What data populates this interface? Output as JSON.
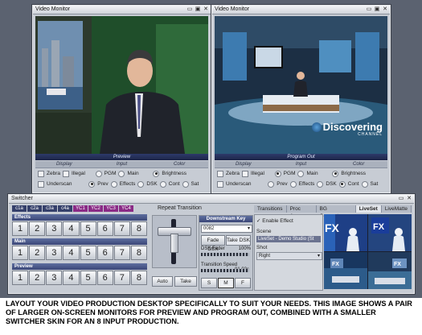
{
  "preview_window": {
    "title": "Video Monitor",
    "bar_label": "Preview",
    "headers": [
      "Display",
      "Input",
      "Color"
    ],
    "row1": {
      "zebra": "Zebra",
      "illegal": "Illegal",
      "pgm": "PGM",
      "main": "Main",
      "brightness": "Brightness"
    },
    "row2": {
      "underscan": "Underscan",
      "prev": "Prev",
      "effects": "Effects",
      "dsk": "DSK",
      "cont": "Cont",
      "sat": "Sat"
    }
  },
  "program_window": {
    "title": "Video Monitor",
    "bar_label": "Program Out",
    "headers": [
      "Display",
      "Input",
      "Color"
    ],
    "row1": {
      "zebra": "Zebra",
      "illegal": "Illegal",
      "pgm": "PGM",
      "main": "Main",
      "brightness": "Brightness"
    },
    "row2": {
      "underscan": "Underscan",
      "prev": "Prev",
      "effects": "Effects",
      "dsk": "DSK",
      "cont": "Cont",
      "sat": "Sat"
    },
    "logo_text": "Discovering",
    "logo_sub": "CHANNEL"
  },
  "switcher": {
    "title": "Switcher",
    "source_tabs": [
      "c1a",
      "c2a",
      "c3a",
      "c4a",
      "YC1",
      "YC2",
      "YC3",
      "YC4"
    ],
    "bus_effects": "Effects",
    "bus_main": "Main",
    "bus_preview": "Preview",
    "buttons": [
      "1",
      "2",
      "3",
      "4",
      "5",
      "6",
      "7",
      "8"
    ],
    "repeat_transition": "Repeat Transition",
    "auto": "Auto",
    "take": "Take",
    "dsk": {
      "header": "Downstream Key",
      "select_value": "0082",
      "fade_dsk": "Fade DSK",
      "take_dsk": "Take DSK",
      "dsk_fader": "DSK Fader",
      "dsk_fader_value": "100%",
      "transition_speed": "Transition Speed",
      "transition_speed_value": "01.02s",
      "speed_s": "S",
      "speed_m": "M",
      "speed_f": "F"
    },
    "fx_tabs": [
      "Transitions",
      "Proc Amp",
      "BG Generator",
      "LiveSet",
      "LiveMatte"
    ],
    "enable_effect": "Enable Effect",
    "scene_label": "Scene",
    "scene_value": "LiveSet - Demo Studio (St",
    "shot_label": "Shot",
    "shot_value": "Right",
    "fx_badge": "FX"
  },
  "caption": "LAYOUT YOUR VIDEO PRODUCTION DESKTOP SPECIFICALLY TO SUIT YOUR NEEDS. THIS IMAGE SHOWS A PAIR OF LARGER ON-SCREEN MONITORS FOR PREVIEW AND PROGRAM OUT, COMBINED WITH A SMALLER SWITCHER SKIN FOR AN 8 INPUT PRODUCTION."
}
